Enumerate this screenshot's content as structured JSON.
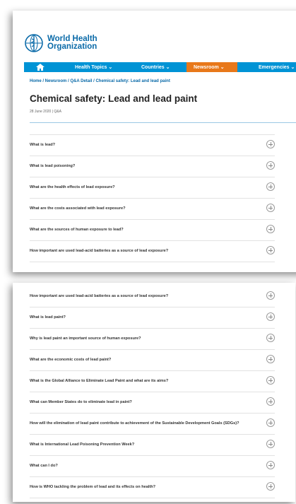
{
  "brand": {
    "line1": "World Health",
    "line2": "Organization"
  },
  "nav": {
    "items": [
      "Health Topics ⌄",
      "Countries ⌄",
      "Newsroom ⌄",
      "Emergencies ⌄"
    ],
    "active_color": "#e8781a",
    "bar_color": "#0093d5"
  },
  "breadcrumb": "Home / Newsroom / Q&A Detail / Chemical safety: Lead and lead paint",
  "page": {
    "title": "Chemical safety: Lead and lead paint",
    "meta": "28 June 2020 | Q&A"
  },
  "faq_part1": [
    "What is lead?",
    "What is lead poisoning?",
    "What are the health effects of lead exposure?",
    "What are the costs associated with lead exposure?",
    "What are the sources of human exposure to lead?",
    "How important are used lead-acid batteries as a source of lead exposure?"
  ],
  "faq_part2": [
    "How important are used lead-acid batteries as a source of lead exposure?",
    "What is lead paint?",
    "Why is lead paint an important source of human exposure?",
    "What are the economic costs of lead paint?",
    "What is the Global Alliance to Eliminate Lead Paint and what are its aims?",
    "What can Member States do to eliminate lead in paint?",
    "How will the elimination of lead paint contribute to achievement of the Sustainable Development Goals (SDGs)?",
    "What is International Lead Poisoning Prevention Week?",
    "What can I do?",
    "How is WHO tackling the problem of lead and its effects on health?"
  ],
  "icons": {
    "expand": "plus-circle-icon",
    "home": "home-icon",
    "logo": "who-emblem-icon"
  }
}
